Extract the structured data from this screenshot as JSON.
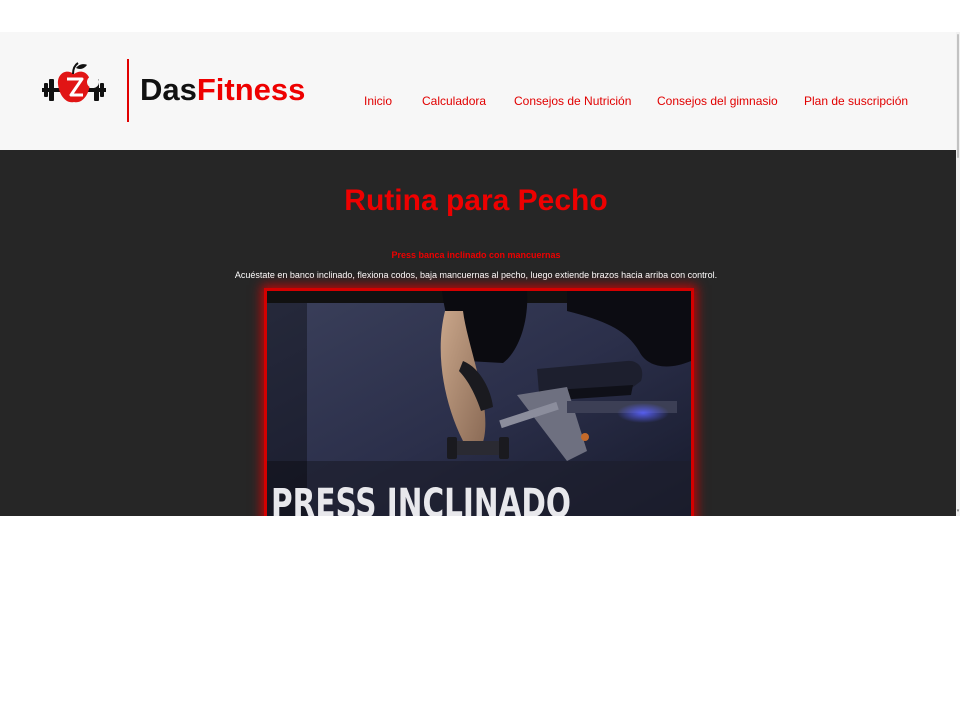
{
  "brand": {
    "name_part1": "Das",
    "name_part2": "Fitness",
    "logo_icon": "apple-dumbbell-icon",
    "accent_color": "#ee0000"
  },
  "nav": {
    "items": [
      {
        "label": "Inicio"
      },
      {
        "label": "Calculadora"
      },
      {
        "label": "Consejos de Nutrición"
      },
      {
        "label": "Consejos del gimnasio"
      },
      {
        "label": "Plan de suscripción"
      }
    ]
  },
  "page": {
    "title": "Rutina para Pecho"
  },
  "exercise": {
    "name": "Press banca inclinado con mancuernas",
    "description": "Acuéstate en banco inclinado, flexiona codos, baja mancuernas al pecho, luego extiende brazos hacia arriba con control.",
    "video_caption": "PRESS INCLINADO"
  },
  "colors": {
    "header_bg": "#f7f7f7",
    "content_bg": "#262626",
    "accent": "#ee0000"
  }
}
